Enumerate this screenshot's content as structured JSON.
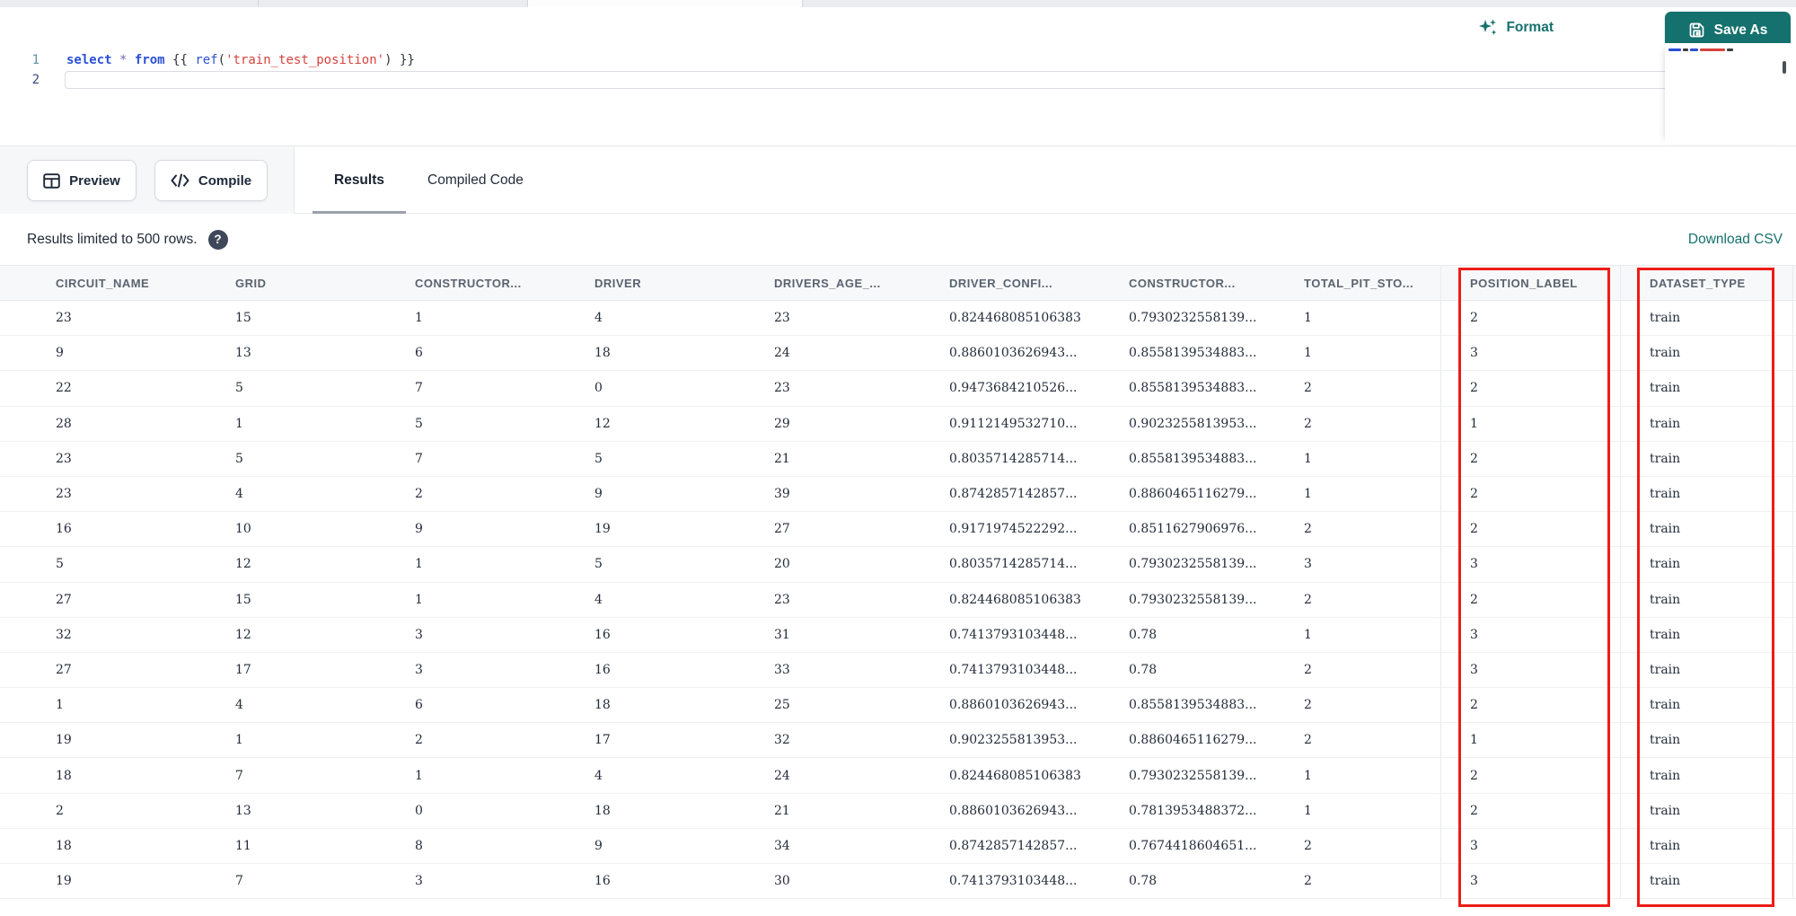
{
  "toolbar": {
    "format_label": "Format",
    "save_as_label": "Save As"
  },
  "editor": {
    "line_numbers": [
      "1",
      "2"
    ],
    "code_line": [
      {
        "type": "keyword",
        "text": "select "
      },
      {
        "type": "operator",
        "text": "* "
      },
      {
        "type": "keyword",
        "text": "from "
      },
      {
        "type": "punct",
        "text": "{{ "
      },
      {
        "type": "function",
        "text": "ref"
      },
      {
        "type": "punct",
        "text": "("
      },
      {
        "type": "string",
        "text": "'train_test_position'"
      },
      {
        "type": "punct",
        "text": ")"
      },
      {
        "type": "punct",
        "text": " }}"
      }
    ]
  },
  "action_bar": {
    "preview_label": "Preview",
    "compile_label": "Compile",
    "tabs": [
      {
        "label": "Results",
        "active": true
      },
      {
        "label": "Compiled Code",
        "active": false
      }
    ]
  },
  "results_bar": {
    "message": "Results limited to 500 rows.",
    "help_icon": "question-mark-icon",
    "download_csv_label": "Download CSV"
  },
  "table": {
    "columns": [
      "CIRCUIT_NAME",
      "GRID",
      "CONSTRUCTOR...",
      "DRIVER",
      "DRIVERS_AGE_...",
      "DRIVER_CONFI...",
      "CONSTRUCTOR...",
      "TOTAL_PIT_STO...",
      "POSITION_LABEL",
      "DATASET_TYPE"
    ],
    "rows": [
      [
        "23",
        "15",
        "1",
        "4",
        "23",
        "0.824468085106383",
        "0.7930232558139...",
        "1",
        "2",
        "train"
      ],
      [
        "9",
        "13",
        "6",
        "18",
        "24",
        "0.8860103626943...",
        "0.8558139534883...",
        "1",
        "3",
        "train"
      ],
      [
        "22",
        "5",
        "7",
        "0",
        "23",
        "0.9473684210526...",
        "0.8558139534883...",
        "2",
        "2",
        "train"
      ],
      [
        "28",
        "1",
        "5",
        "12",
        "29",
        "0.9112149532710...",
        "0.9023255813953...",
        "2",
        "1",
        "train"
      ],
      [
        "23",
        "5",
        "7",
        "5",
        "21",
        "0.8035714285714...",
        "0.8558139534883...",
        "1",
        "2",
        "train"
      ],
      [
        "23",
        "4",
        "2",
        "9",
        "39",
        "0.8742857142857...",
        "0.8860465116279...",
        "1",
        "2",
        "train"
      ],
      [
        "16",
        "10",
        "9",
        "19",
        "27",
        "0.9171974522292...",
        "0.8511627906976...",
        "2",
        "2",
        "train"
      ],
      [
        "5",
        "12",
        "1",
        "5",
        "20",
        "0.8035714285714...",
        "0.7930232558139...",
        "3",
        "3",
        "train"
      ],
      [
        "27",
        "15",
        "1",
        "4",
        "23",
        "0.824468085106383",
        "0.7930232558139...",
        "2",
        "2",
        "train"
      ],
      [
        "32",
        "12",
        "3",
        "16",
        "31",
        "0.7413793103448...",
        "0.78",
        "1",
        "3",
        "train"
      ],
      [
        "27",
        "17",
        "3",
        "16",
        "33",
        "0.7413793103448...",
        "0.78",
        "2",
        "3",
        "train"
      ],
      [
        "1",
        "4",
        "6",
        "18",
        "25",
        "0.8860103626943...",
        "0.8558139534883...",
        "2",
        "2",
        "train"
      ],
      [
        "19",
        "1",
        "2",
        "17",
        "32",
        "0.9023255813953...",
        "0.8860465116279...",
        "2",
        "1",
        "train"
      ],
      [
        "18",
        "7",
        "1",
        "4",
        "24",
        "0.824468085106383",
        "0.7930232558139...",
        "1",
        "2",
        "train"
      ],
      [
        "2",
        "13",
        "0",
        "18",
        "21",
        "0.8860103626943...",
        "0.7813953488372...",
        "1",
        "2",
        "train"
      ],
      [
        "18",
        "11",
        "8",
        "9",
        "34",
        "0.8742857142857...",
        "0.7674418604651...",
        "2",
        "3",
        "train"
      ],
      [
        "19",
        "7",
        "3",
        "16",
        "30",
        "0.7413793103448...",
        "0.78",
        "2",
        "3",
        "train"
      ]
    ],
    "highlighted_columns": [
      "POSITION_LABEL",
      "DATASET_TYPE"
    ]
  },
  "colors": {
    "accent_teal": "#15716d",
    "annotation_red": "#ee1c17",
    "keyword_blue": "#2b50d6",
    "string_red": "#d6433d",
    "header_bg": "#f7f8f9"
  }
}
